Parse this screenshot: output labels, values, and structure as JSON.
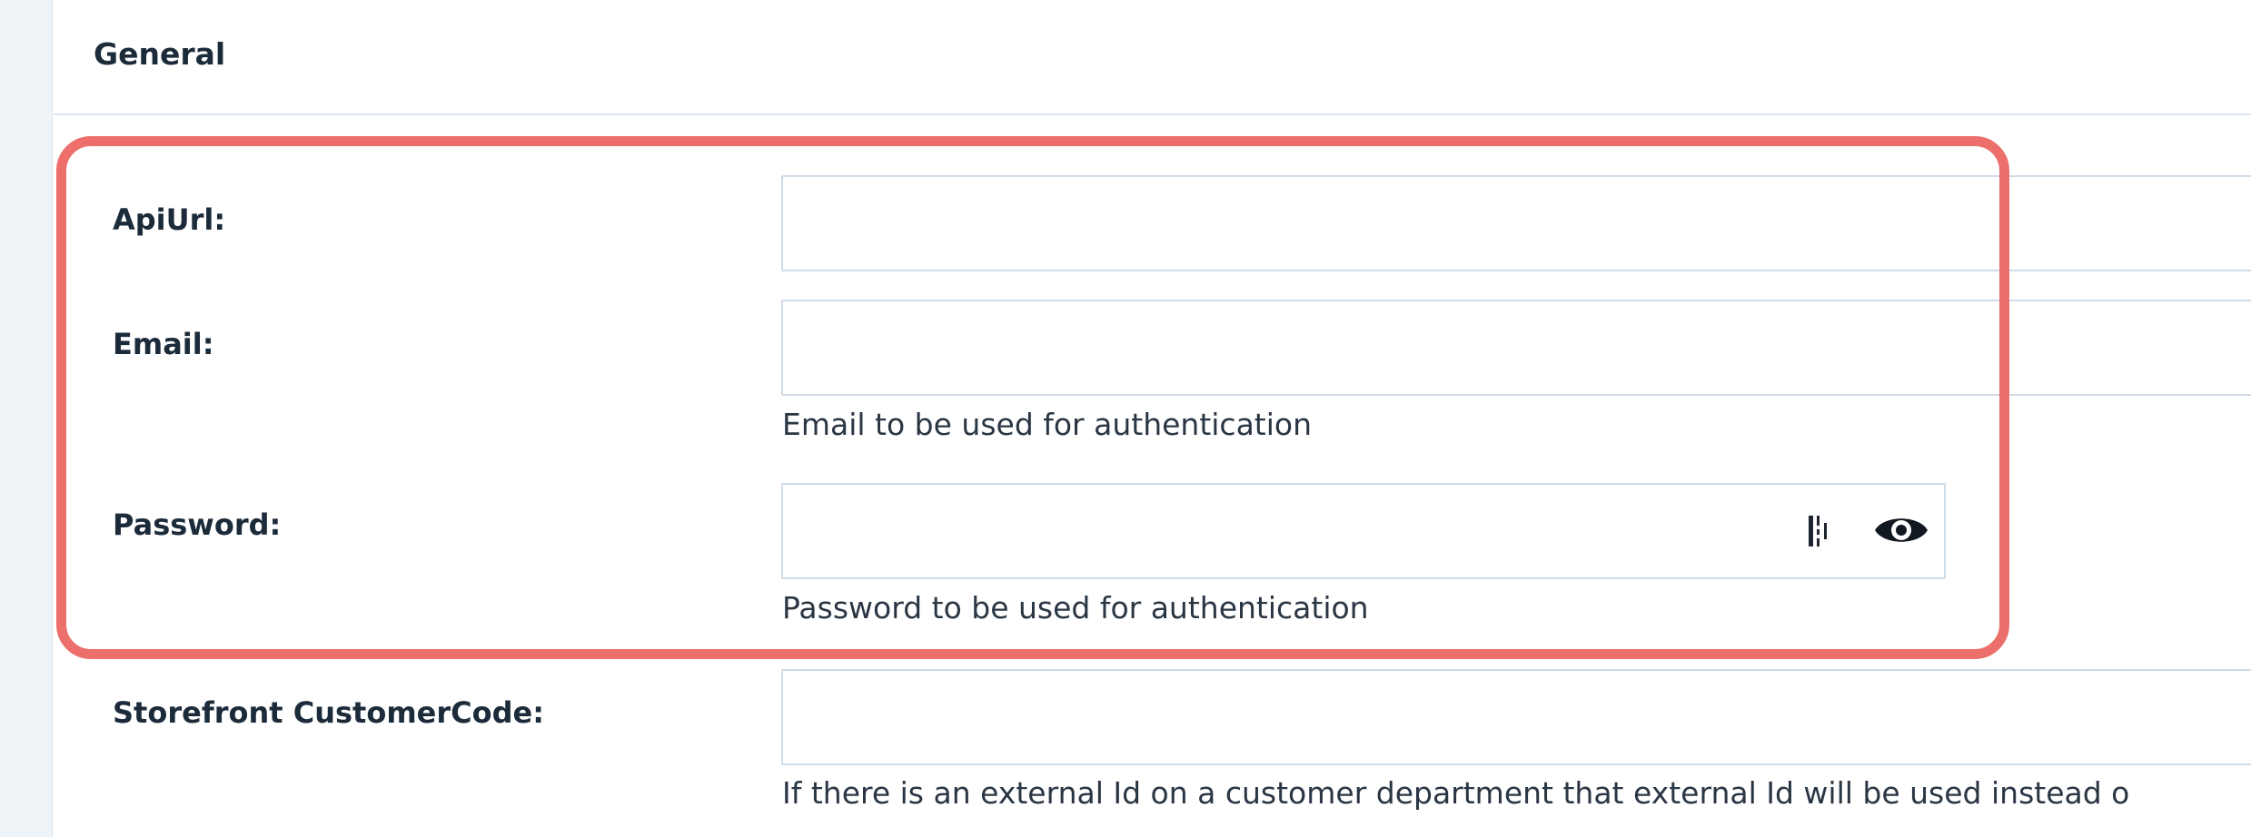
{
  "section": {
    "title": "General"
  },
  "fields": {
    "api_url": {
      "label": "ApiUrl:",
      "value": ""
    },
    "email": {
      "label": "Email:",
      "value": "",
      "help": "Email to be used for authentication"
    },
    "password": {
      "label": "Password:",
      "value": "",
      "help": "Password to be used for authentication"
    },
    "storefront_customer_code": {
      "label": "Storefront CustomerCode:",
      "value": "",
      "help": "If there is an external Id on a customer department that external Id will be used instead o"
    }
  },
  "icons": {
    "password_manager": "password-manager-icon",
    "show_password": "eye-icon"
  },
  "colors": {
    "highlight": "#ec6f6b",
    "label_text": "#1c2b3a",
    "input_border": "#cfdbe7",
    "side_strip": "#eef3f8"
  }
}
